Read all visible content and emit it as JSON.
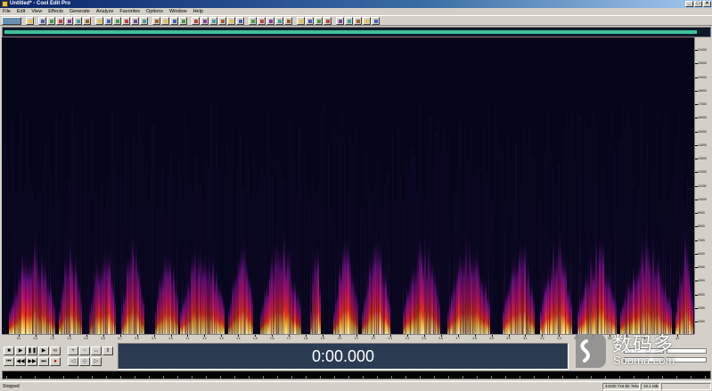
{
  "window": {
    "title": "Untitled* - Cool Edit Pro"
  },
  "menu": [
    "File",
    "Edit",
    "View",
    "Effects",
    "Generate",
    "Analyze",
    "Favorites",
    "Options",
    "Window",
    "Help"
  ],
  "toolbar_icons": [
    "new-icon",
    "open-icon",
    "save-icon",
    "cut-icon",
    "copy-icon",
    "paste-icon",
    "mix-paste-icon",
    "undo-icon",
    "repeat-icon",
    "trim-icon",
    "view-waveform-icon",
    "view-spectral-icon",
    "zoom-icon",
    "settings-icon"
  ],
  "frequency_ruler": {
    "labels": [
      "21000",
      "20000",
      "19000",
      "18000",
      "17000",
      "16000",
      "15000",
      "14000",
      "13000",
      "12000",
      "11000",
      "10000",
      "9000",
      "8000",
      "7000",
      "6000",
      "5000",
      "4000",
      "3000",
      "2000",
      "1000"
    ]
  },
  "time_ruler": {
    "labels": [
      "0.1",
      "0.2",
      "0.3",
      "0.4",
      "0.5",
      "0.6",
      "0.7",
      "0.8",
      "0.9",
      "1.0",
      "1.1",
      "1.2",
      "1.3",
      "1.4",
      "1.5",
      "1.6",
      "1.7",
      "1.8",
      "1.9",
      "2.0",
      "2.1",
      "2.2",
      "2.3",
      "2.4",
      "2.5",
      "2.6",
      "2.7",
      "2.8",
      "2.9",
      "3.0",
      "3.1",
      "3.2",
      "3.3",
      "3.4",
      "3.5",
      "3.6",
      "3.7",
      "3.8",
      "3.9",
      "4.0"
    ]
  },
  "transport": {
    "buttons": [
      "stop",
      "play",
      "pause",
      "play-loop",
      "loop",
      "go-start",
      "rewind",
      "forward",
      "go-end",
      "record"
    ]
  },
  "time_display": "0:00.000",
  "status_bar": {
    "status": "Stopped",
    "format": "44100 ?16-bit ?Mono",
    "size": "10.1 MB"
  },
  "watermark": {
    "cn": "数码多",
    "en": "Sooma.com"
  },
  "colors": {
    "spectral_bg": "#06061a",
    "overview_range": "#3fc09a",
    "time_display_bg": "#2a3b52"
  }
}
